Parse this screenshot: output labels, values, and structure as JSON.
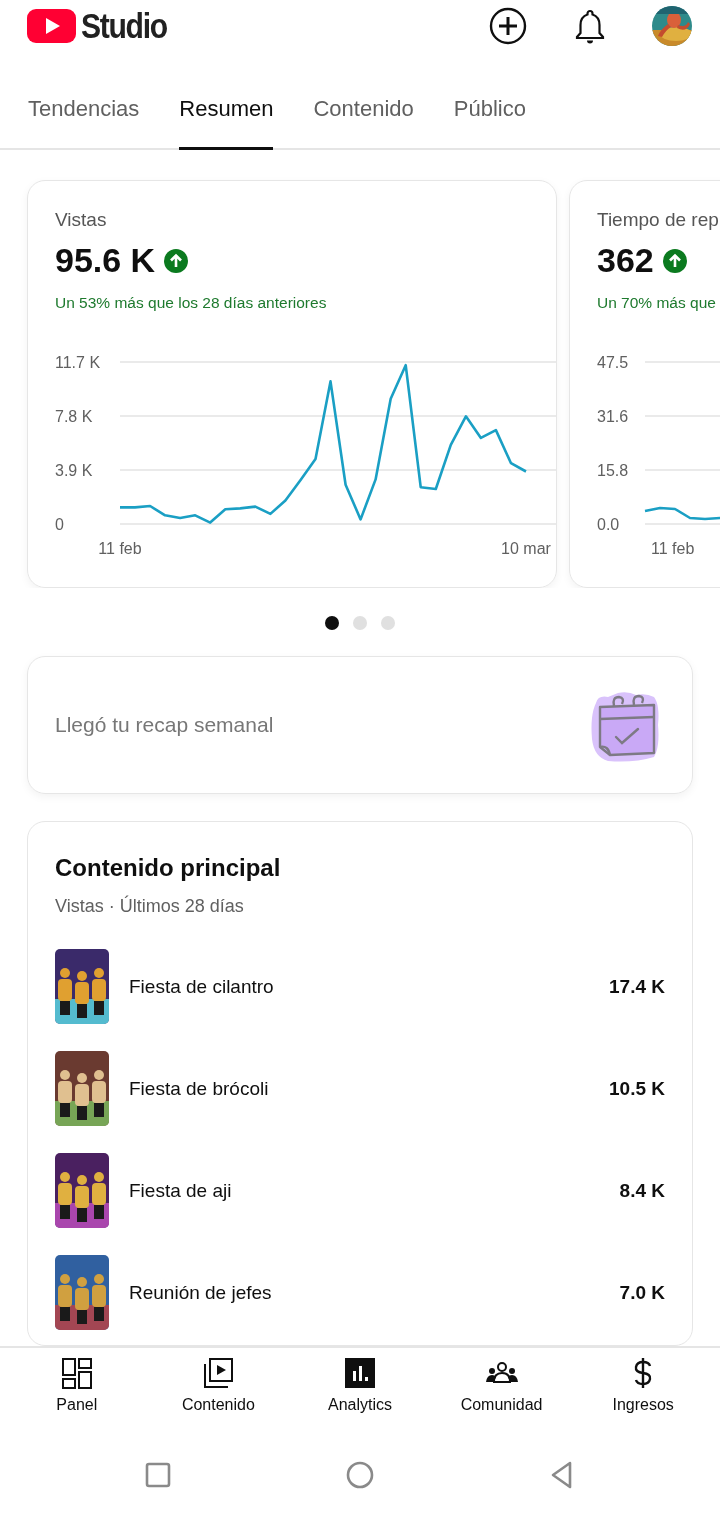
{
  "app": {
    "logo_text": "Studio"
  },
  "tabs": [
    {
      "label": "Tendencias",
      "selected": false
    },
    {
      "label": "Resumen",
      "selected": true
    },
    {
      "label": "Contenido",
      "selected": false
    },
    {
      "label": "Público",
      "selected": false
    }
  ],
  "metric_cards": [
    {
      "label": "Vistas",
      "value": "95.6 K",
      "increase": true,
      "comparison": "Un 53% más que los 28 días anteriores",
      "chart_data": {
        "type": "line",
        "categories": [
          "11 feb",
          null,
          null,
          null,
          null,
          null,
          null,
          null,
          null,
          null,
          null,
          null,
          null,
          null,
          null,
          null,
          null,
          null,
          null,
          null,
          null,
          null,
          null,
          null,
          null,
          null,
          null,
          "10 mar"
        ],
        "ylim": [
          0,
          11700
        ],
        "yticks": [
          {
            "value": 0,
            "label": "0"
          },
          {
            "value": 3900,
            "label": "3.9 K"
          },
          {
            "value": 7800,
            "label": "7.8 K"
          },
          {
            "value": 11700,
            "label": "11.7 K"
          }
        ],
        "series": [
          {
            "color": "#1a9fc4",
            "values": [
              1200,
              1200,
              1300,
              630,
              430,
              630,
              100,
              1060,
              1130,
              1260,
              730,
              1700,
              3160,
              4690,
              10300,
              2830,
              330,
              3220,
              9040,
              11470,
              2660,
              2530,
              5720,
              7780,
              6220,
              6780,
              4390,
              3790
            ]
          }
        ]
      }
    },
    {
      "label": "Tiempo de rep",
      "value": "362",
      "increase": true,
      "comparison": "Un 70% más que",
      "axis_labels": [
        "47.5",
        "31.6",
        "15.8",
        "0.0"
      ],
      "x_label": "11 feb"
    }
  ],
  "carousel_dots": [
    {
      "selected": true
    },
    {
      "selected": false
    },
    {
      "selected": false
    }
  ],
  "recap_card": {
    "text": "Llegó tu recap semanal"
  },
  "top_content": {
    "title": "Contenido principal",
    "subtitle": "Vistas · Últimos 28 días",
    "items": [
      {
        "title": "Fiesta de cilantro",
        "views": "17.4 K",
        "kind": "picture"
      },
      {
        "title": "Fiesta de brócoli",
        "views": "10.5 K",
        "kind": "picture"
      },
      {
        "title": "Fiesta de aji",
        "views": "8.4 K",
        "kind": "picture"
      },
      {
        "title": "Reunión de jefes",
        "views": "7.0 K",
        "kind": "picture"
      }
    ]
  },
  "bottom_nav": [
    {
      "label": "Panel",
      "selected": false
    },
    {
      "label": "Contenido",
      "selected": false
    },
    {
      "label": "Analytics",
      "selected": true
    },
    {
      "label": "Comunidad",
      "selected": false
    },
    {
      "label": "Ingresos",
      "selected": false
    }
  ]
}
